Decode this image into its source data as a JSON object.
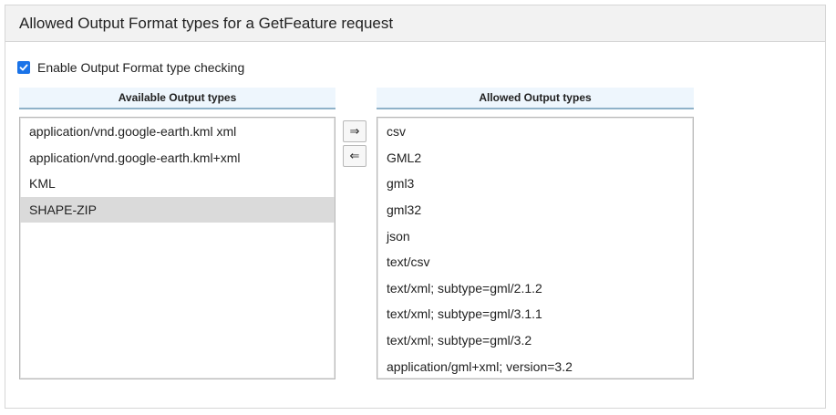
{
  "panel": {
    "title": "Allowed Output Format types for a GetFeature request"
  },
  "checkbox": {
    "label": "Enable Output Format type checking",
    "checked": true
  },
  "available": {
    "header": "Available Output types",
    "items": [
      "application/vnd.google-earth.kml xml",
      "application/vnd.google-earth.kml+xml",
      "KML",
      "SHAPE-ZIP"
    ],
    "selected_item": "SHAPE-ZIP"
  },
  "allowed": {
    "header": "Allowed Output types",
    "items": [
      "csv",
      "GML2",
      "gml3",
      "gml32",
      "json",
      "text/csv",
      "text/xml; subtype=gml/2.1.2",
      "text/xml; subtype=gml/3.1.1",
      "text/xml; subtype=gml/3.2",
      "application/gml+xml; version=3.2"
    ]
  },
  "buttons": {
    "add": "⇒",
    "remove": "⇐"
  },
  "colors": {
    "checkbox": "#1a73e8",
    "selected_row": "#dadada",
    "column_header_bg": "#eef6fd",
    "column_header_border": "#8fb2c9"
  }
}
